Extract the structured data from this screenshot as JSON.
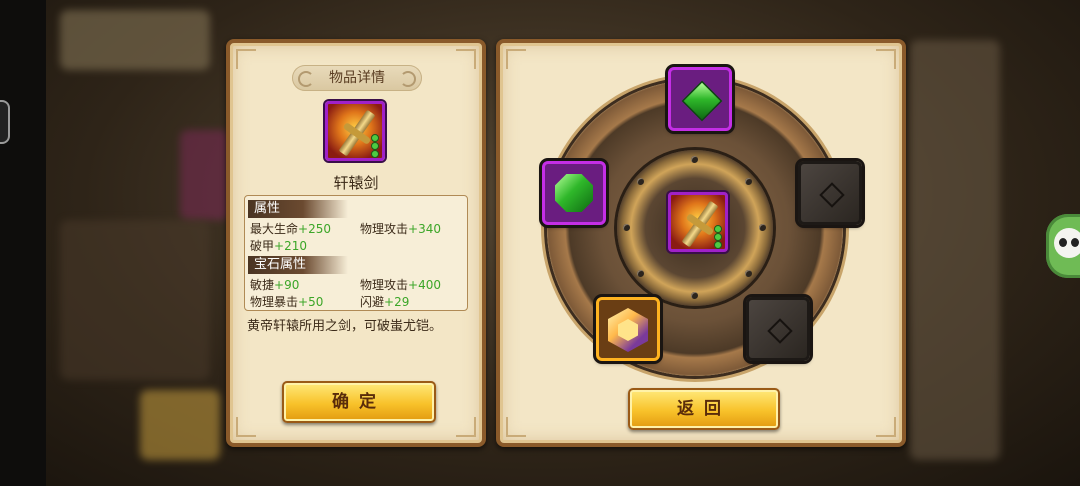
{
  "item_details": {
    "title": "物品详情",
    "item_name": "轩辕剑",
    "sections": {
      "attributes": {
        "heading": "属性",
        "stats": [
          {
            "label": "最大生命",
            "value": "+250"
          },
          {
            "label": "物理攻击",
            "value": "+340"
          },
          {
            "label": "破甲",
            "value": "+210"
          }
        ]
      },
      "gem_attributes": {
        "heading": "宝石属性",
        "stats": [
          {
            "label": "敏捷",
            "value": "+90"
          },
          {
            "label": "物理攻击",
            "value": "+400"
          },
          {
            "label": "物理暴击",
            "value": "+50"
          },
          {
            "label": "闪避",
            "value": "+29"
          }
        ]
      }
    },
    "description": "黄帝轩辕所用之剑，可破蚩尤铠。",
    "confirm_label": "确定"
  },
  "gem_socket": {
    "center_item_icon": "sword-icon",
    "slots": [
      {
        "position": "top",
        "state": "filled",
        "gem_icon": "green-crystal-icon",
        "rarity_color": "#c42ee6"
      },
      {
        "position": "left",
        "state": "filled",
        "gem_icon": "green-gem-icon",
        "rarity_color": "#c42ee6"
      },
      {
        "position": "right",
        "state": "empty",
        "gem_icon": "empty-slot-icon"
      },
      {
        "position": "bottom-left",
        "state": "filled",
        "gem_icon": "amber-hex-gem-icon",
        "rarity_color": "#ffb320"
      },
      {
        "position": "bottom-right",
        "state": "empty",
        "gem_icon": "empty-slot-icon"
      }
    ],
    "back_label": "返回"
  },
  "colors": {
    "stat_value": "#3ca628",
    "panel_bg": "#f3e6c6",
    "button_gold": "#f8c22a"
  }
}
